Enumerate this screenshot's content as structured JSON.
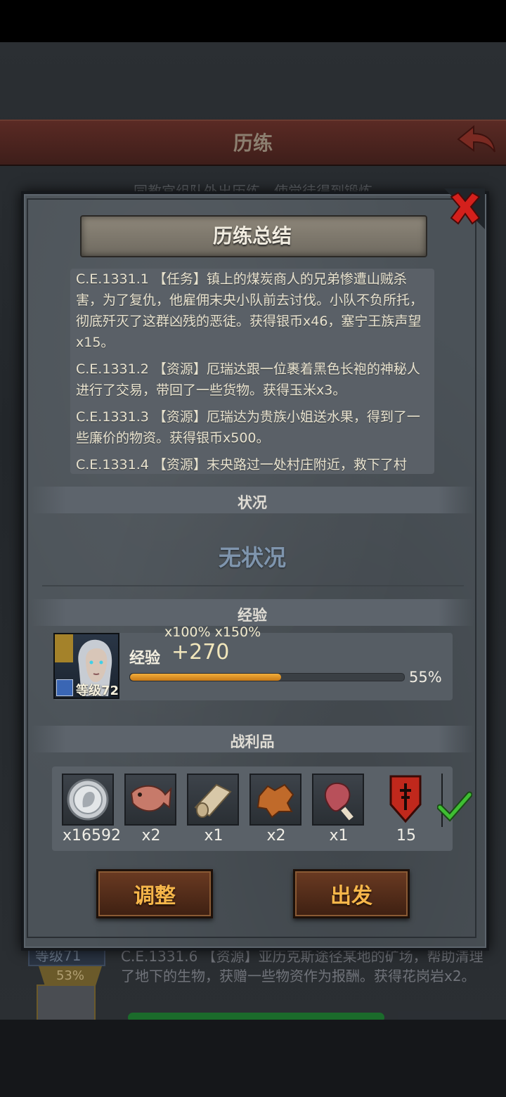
{
  "background": {
    "header_title": "历练",
    "subtitle": "同教宫组队外出历练，使觉徒得到锻炼",
    "level_badge": "等级71",
    "percent_badge": "53%",
    "log_line": "C.E.1331.6 【资源】亚历克斯途径某地的矿场，帮助清理了地下的生物，获赠一些物资作为报酬。获得花岗岩x2。"
  },
  "modal": {
    "title": "历练总结",
    "log_entries": [
      "C.E.1331.1 【任务】镇上的煤炭商人的兄弟惨遭山贼杀害，为了复仇，他雇佣末央小队前去讨伐。小队不负所托，彻底歼灭了这群凶残的恶徒。获得银币x46，塞宁王族声望x15。",
      "C.E.1331.2 【资源】厄瑞达跟一位裹着黑色长袍的神秘人进行了交易，带回了一些货物。获得玉米x3。",
      "C.E.1331.3 【资源】厄瑞达为贵族小姐送水果，得到了一些廉价的物资。获得银币x500。",
      "C.E.1331.4 【资源】末央路过一处村庄附近，救下了村"
    ],
    "status_section_label": "状况",
    "status_text": "无状况",
    "exp_section_label": "经验",
    "exp": {
      "multipliers": "x100%  x150%",
      "label": "经验",
      "gain": "+270",
      "progress": 0.55,
      "percent_text": "55%",
      "hero_level": "等级72"
    },
    "loot_section_label": "战利品",
    "loot": [
      {
        "icon": "silver-coin-icon",
        "count": "x16592"
      },
      {
        "icon": "fish-icon",
        "count": "x2"
      },
      {
        "icon": "cloth-roll-icon",
        "count": "x1"
      },
      {
        "icon": "leather-hide-icon",
        "count": "x2"
      },
      {
        "icon": "meat-leg-icon",
        "count": "x1"
      },
      {
        "icon": "reputation-shield-icon",
        "count": "15"
      }
    ],
    "buttons": {
      "adjust": "调整",
      "depart": "出发"
    }
  },
  "colors": {
    "exp_bar": "#e8992c",
    "button_text": "#f6b64a",
    "close_red": "#d4201c",
    "check_green": "#3fbf33"
  }
}
